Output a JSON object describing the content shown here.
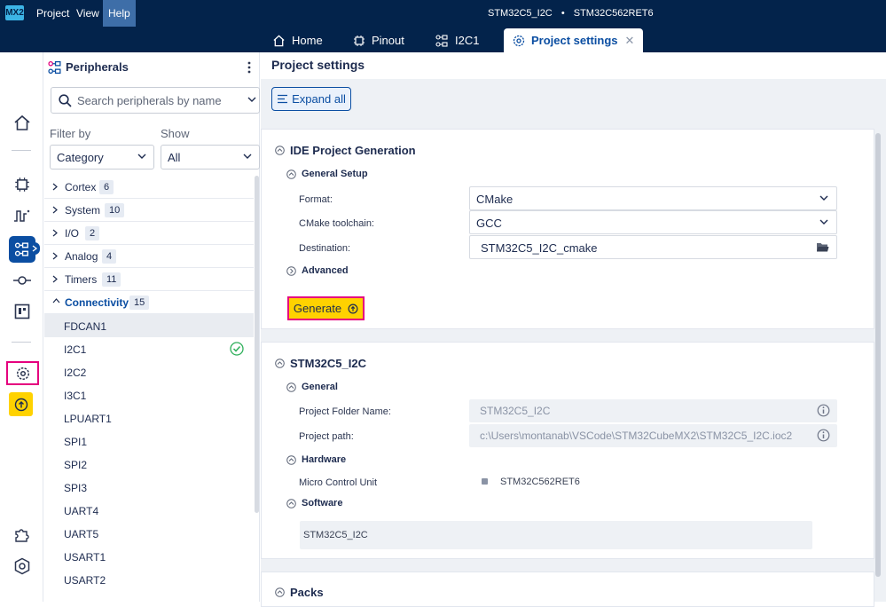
{
  "app": {
    "logo": "MX2",
    "menu": [
      "Project",
      "View",
      "Help"
    ],
    "project_name": "STM32C5_I2C",
    "separator": "•",
    "mcu": "STM32C562RET6"
  },
  "tabs": [
    {
      "label": "Home",
      "icon": "home-icon"
    },
    {
      "label": "Pinout",
      "icon": "chip-icon"
    },
    {
      "label": "I2C1",
      "icon": "peripherals-icon"
    },
    {
      "label": "Project settings",
      "icon": "gear-icon",
      "active": true,
      "close": "✕"
    }
  ],
  "peripherals": {
    "title": "Peripherals",
    "search_placeholder": "Search peripherals by name",
    "filter_label": "Filter by",
    "show_label": "Show",
    "filter_value": "Category",
    "show_value": "All",
    "categories": [
      {
        "name": "Cortex",
        "count": "6"
      },
      {
        "name": "System",
        "count": "10"
      },
      {
        "name": "I/O",
        "count": "2"
      },
      {
        "name": "Analog",
        "count": "4"
      },
      {
        "name": "Timers",
        "count": "11"
      },
      {
        "name": "Connectivity",
        "count": "15"
      }
    ],
    "items": [
      "FDCAN1",
      "I2C1",
      "I2C2",
      "I3C1",
      "LPUART1",
      "SPI1",
      "SPI2",
      "SPI3",
      "UART4",
      "UART5",
      "USART1",
      "USART2"
    ]
  },
  "main": {
    "title": "Project settings",
    "expand_all": "Expand all",
    "ide": {
      "title": "IDE Project Generation",
      "general_setup": "General Setup",
      "format_label": "Format:",
      "format_value": "CMake",
      "toolchain_label": "CMake toolchain:",
      "toolchain_value": "GCC",
      "destination_label": "Destination:",
      "destination_value": "STM32C5_I2C_cmake",
      "advanced": "Advanced",
      "generate": "Generate"
    },
    "project": {
      "title": "STM32C5_I2C",
      "general": "General",
      "folder_label": "Project Folder Name:",
      "folder_value": "STM32C5_I2C",
      "path_label": "Project path:",
      "path_value": "c:\\Users\\montanab\\VSCode\\STM32CubeMX2\\STM32C5_I2C.ioc2",
      "hardware": "Hardware",
      "mcu_label": "Micro Control Unit",
      "mcu_value": "STM32C562RET6",
      "software": "Software",
      "software_value": "STM32C5_I2C"
    },
    "packs": {
      "title": "Packs"
    }
  },
  "colors": {
    "navy": "#03234b",
    "accent_blue": "#0b4ea2",
    "highlight_pink": "#e5007e",
    "generate_yellow": "#ffd200",
    "ok_green": "#2eaf5a"
  }
}
